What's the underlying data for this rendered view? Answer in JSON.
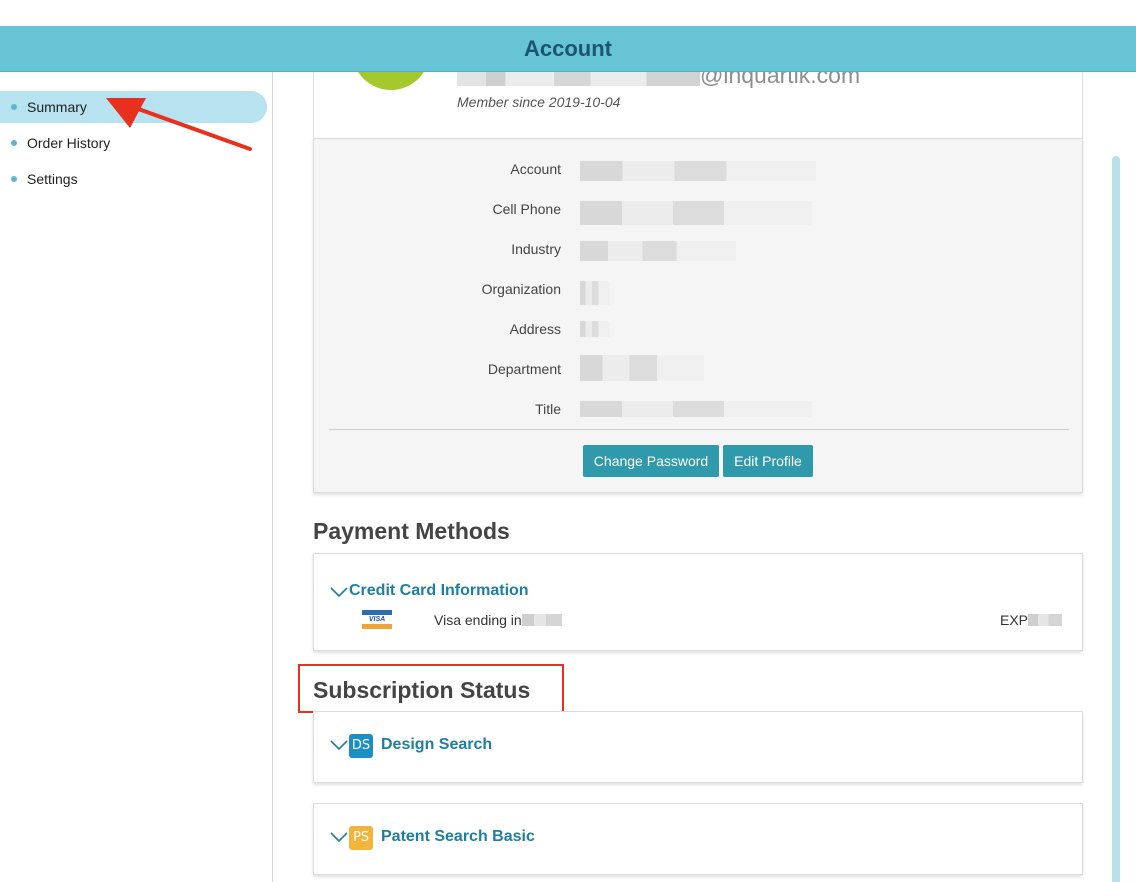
{
  "header": {
    "title": "Account"
  },
  "sidebar": {
    "items": [
      {
        "label": "Summary",
        "active": true
      },
      {
        "label": "Order History",
        "active": false
      },
      {
        "label": "Settings",
        "active": false
      }
    ]
  },
  "profile": {
    "email_domain": "@inquartik.com",
    "member_since": "Member since 2019-10-04"
  },
  "details": {
    "rows": [
      {
        "label": "Account",
        "value": "",
        "redacted": true
      },
      {
        "label": "Cell Phone",
        "value": "",
        "redacted": true
      },
      {
        "label": "Industry",
        "value": "",
        "redacted": true
      },
      {
        "label": "Organization",
        "value": "",
        "redacted": true
      },
      {
        "label": "Address",
        "value": "",
        "redacted": true
      },
      {
        "label": "Department",
        "value": "",
        "redacted": true
      },
      {
        "label": "Title",
        "value": "",
        "redacted": true
      }
    ],
    "change_password_label": "Change Password",
    "edit_profile_label": "Edit Profile"
  },
  "payment": {
    "section_title": "Payment Methods",
    "card_header": "Credit Card Information",
    "card_brand": "VISA",
    "visa_text": "Visa ending in",
    "exp_text": "EXP"
  },
  "subscription": {
    "section_title": "Subscription Status",
    "items": [
      {
        "label": "Design Search",
        "badge": "DS",
        "badge_color": "#1b8fc4"
      },
      {
        "label": "Patent Search Basic",
        "badge": "PS",
        "badge_color": "#f2b43a"
      }
    ]
  },
  "colors": {
    "header_bg": "#66c4d4",
    "accent": "#2e9aab",
    "link": "#1e7fa1",
    "annotation": "#e8301e"
  }
}
